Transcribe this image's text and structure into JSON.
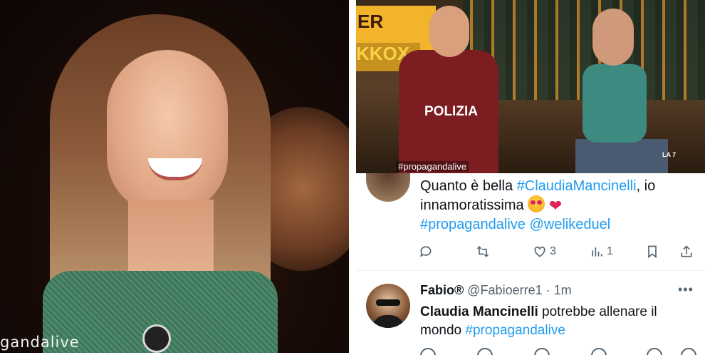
{
  "left_photo": {
    "hashtag_overlay": "gandalive"
  },
  "right_photo": {
    "sign_text": "ER GIULIO",
    "sign_text_2": "KKOX",
    "jersey_text": "POLIZIA",
    "hashtag_overlay": "#propagandalive",
    "channel_logo": "LA 7"
  },
  "tweet1": {
    "text_prefix": "Quanto è bella ",
    "mention_hashtag": "#ClaudiaMancinelli",
    "text_suffix": ", io innamoratissima ",
    "link_hashtag": "#propagandalive",
    "link_mention": "@welikeduel",
    "actions": {
      "reply": "",
      "retweet": "",
      "likes": "3",
      "views": "1",
      "bookmark": "",
      "share": ""
    }
  },
  "tweet2": {
    "display_name": "Fabio®",
    "handle": "@Fabioerre1",
    "separator": " · ",
    "time": "1m",
    "more": "•••",
    "text_bold": "Claudia Mancinelli",
    "text_rest": " potrebbe allenare il mondo ",
    "hashtag": "#propagandalive"
  },
  "colors": {
    "link": "#1d9bf0",
    "text": "#0f1419",
    "muted": "#536471"
  }
}
